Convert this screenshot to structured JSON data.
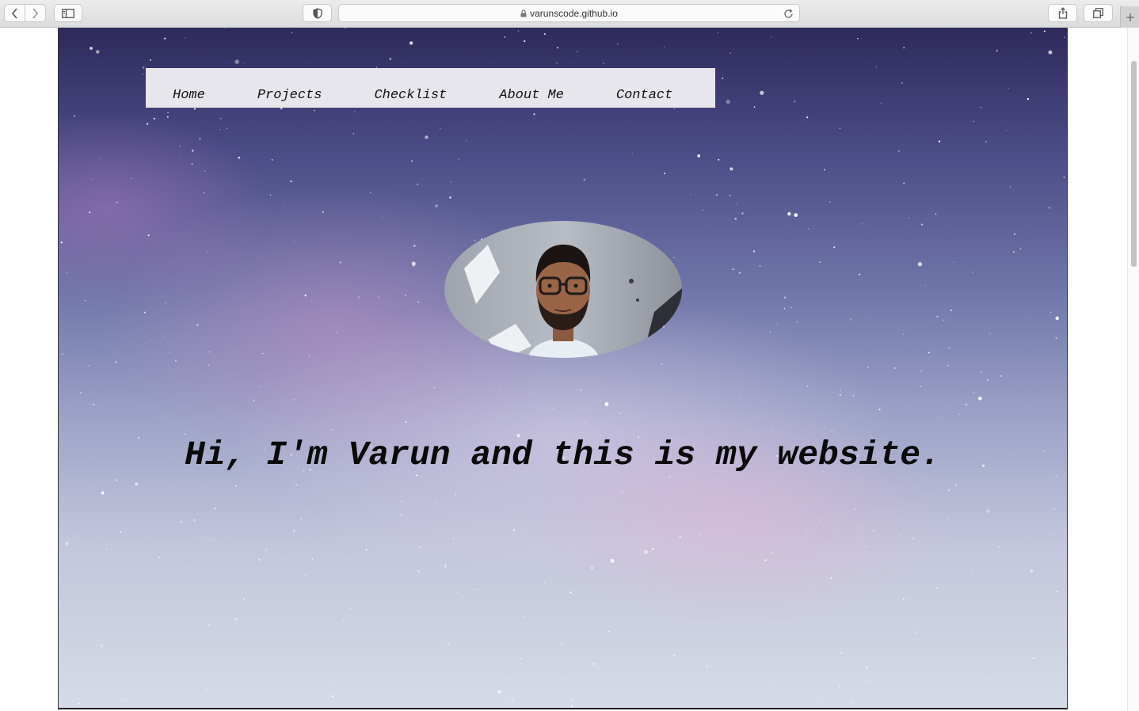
{
  "browser": {
    "url": "varunscode.github.io",
    "icons": {
      "back": "chevron-left-icon",
      "forward": "chevron-right-icon",
      "sidebar": "sidebar-icon",
      "privacy": "shield-icon",
      "lock": "lock-icon",
      "reload": "reload-icon",
      "share": "share-icon",
      "tabs": "tabs-icon",
      "new_tab": "plus-icon"
    }
  },
  "nav": {
    "items": [
      {
        "label": "Home"
      },
      {
        "label": "Projects"
      },
      {
        "label": "Checklist"
      },
      {
        "label": "About Me"
      },
      {
        "label": "Contact"
      }
    ]
  },
  "hero": {
    "headline": "Hi, I'm Varun and this is my website."
  },
  "colors": {
    "nav_background": "#e6e6ec",
    "headline_text": "#0a0a0a",
    "sky_top": "#2e2a5c",
    "sky_bottom": "#d5dbe6"
  }
}
